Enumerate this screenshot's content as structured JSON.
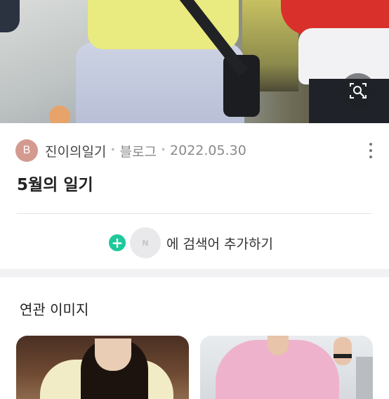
{
  "post": {
    "avatar_letter": "B",
    "blog_name": "진이의일기",
    "blog_type": "블로그",
    "date": "2022.05.30",
    "title": "5월의 일기"
  },
  "search": {
    "plus_symbol": "+",
    "badge_letter": "N",
    "add_text": "에 검색어 추가하기"
  },
  "related": {
    "title": "연관 이미지"
  },
  "icons": {
    "lens": "image-search-icon",
    "more": "more-vertical-icon",
    "add": "plus-circle-icon"
  },
  "colors": {
    "accent_green": "#1ec89a",
    "avatar_bg": "#d49a8f"
  }
}
